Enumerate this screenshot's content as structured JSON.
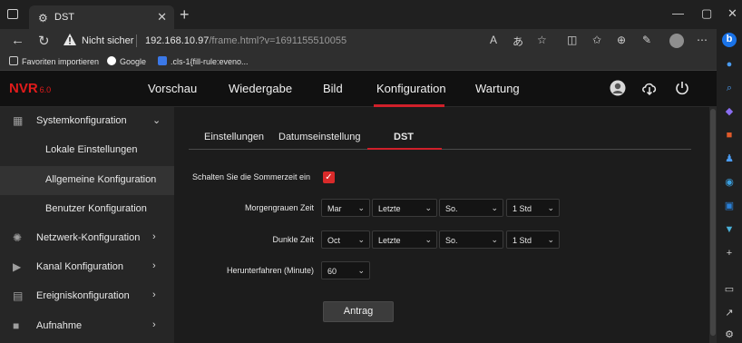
{
  "browser": {
    "tab_title": "DST",
    "new_tab": "+",
    "security_warning": "Nicht sicher",
    "url_host": "192.168.10.97",
    "url_path": "/frame.html?v=1691155510055",
    "favorites": [
      {
        "label": "Favoriten importieren"
      },
      {
        "label": "Google"
      },
      {
        "label": ".cls-1{fill-rule:eveno..."
      }
    ]
  },
  "app": {
    "logo": "NVR",
    "version": "6.0",
    "menu": [
      {
        "label": "Vorschau"
      },
      {
        "label": "Wiedergabe"
      },
      {
        "label": "Bild"
      },
      {
        "label": "Konfiguration"
      },
      {
        "label": "Wartung"
      }
    ],
    "active_menu": "Konfiguration"
  },
  "sidebar": {
    "items": [
      {
        "label": "Systemkonfiguration",
        "icon": "system-config-icon",
        "expanded": true
      },
      {
        "label": "Lokale Einstellungen"
      },
      {
        "label": "Allgemeine Konfiguration",
        "active": true
      },
      {
        "label": "Benutzer Konfiguration"
      },
      {
        "label": "Netzwerk-Konfiguration",
        "icon": "network-icon"
      },
      {
        "label": "Kanal Konfiguration",
        "icon": "camera-icon"
      },
      {
        "label": "Ereigniskonfiguration",
        "icon": "event-icon"
      },
      {
        "label": "Aufnahme",
        "icon": "recording-icon"
      }
    ]
  },
  "subtabs": [
    {
      "label": "Einstellungen"
    },
    {
      "label": "Datumseinstellung"
    },
    {
      "label": "DST",
      "active": true
    }
  ],
  "form": {
    "enable_label": "Schalten Sie die Sommerzeit ein",
    "enable_checked": true,
    "start_label": "Morgengrauen Zeit",
    "start_month": "Mar",
    "start_week": "Letzte",
    "start_day": "So.",
    "start_hour": "1 Std",
    "end_label": "Dunkle Zeit",
    "end_month": "Oct",
    "end_week": "Letzte",
    "end_day": "So.",
    "end_hour": "1 Std",
    "offset_label": "Herunterfahren (Minute)",
    "offset_value": "60",
    "apply_label": "Antrag"
  },
  "colors": {
    "accent": "#d0202a",
    "logo": "#e01b1b",
    "checkbox": "#d92a2a"
  }
}
